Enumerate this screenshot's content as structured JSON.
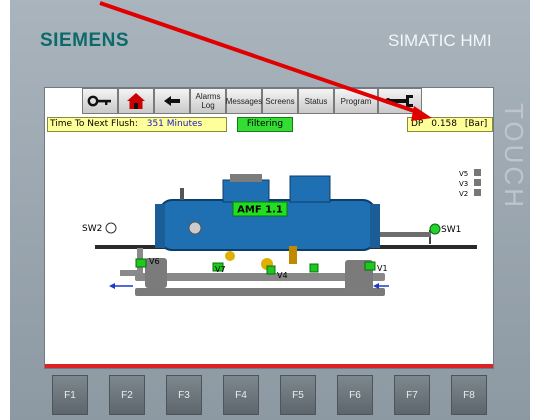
{
  "panel": {
    "brand": "SIEMENS",
    "product": "SIMATIC HMI",
    "side_text": "TOUCH"
  },
  "toolbar": {
    "alarms_log": "Alarms\nLog",
    "messages": "Messages",
    "screens": "Screens",
    "status": "Status",
    "program": "Program"
  },
  "flush": {
    "label": "Time To Next Flush:",
    "value": "351 Minutes"
  },
  "status": {
    "label": "Filtering"
  },
  "dp": {
    "label": "DP",
    "value": "0.158",
    "unit": "[Bar]"
  },
  "diagram": {
    "unit_label": "AMF 1.1",
    "valves": {
      "sw1": "SW1",
      "sw2": "SW2",
      "v1": "V1",
      "v4": "V4",
      "v6": "V6",
      "v7": "V7"
    },
    "legend": [
      "V5",
      "V3",
      "V2"
    ]
  },
  "function_keys": [
    "F1",
    "F2",
    "F3",
    "F4",
    "F5",
    "F6",
    "F7",
    "F8"
  ],
  "colors": {
    "status_ok": "#33dd33",
    "info_box": "#ffff99",
    "tank": "#1f6fb3",
    "annotation_arrow": "#e00000",
    "brand": "#0e6a6a"
  }
}
